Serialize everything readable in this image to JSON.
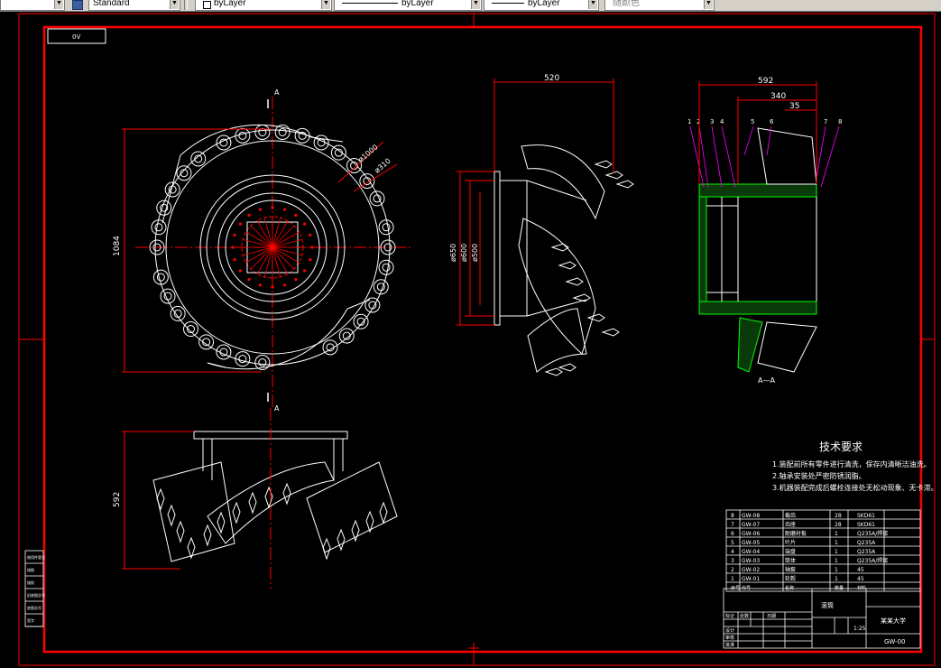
{
  "toolbar": {
    "text_style": "Standard",
    "layer": "byLayer",
    "linetype": "byLayer",
    "lineweight": "byLayer",
    "plot_color": "随颜色"
  },
  "drawing": {
    "sheet_tag": "0V",
    "dims": {
      "width_520": "520",
      "width_592": "592",
      "width_340": "340",
      "width_35": "35",
      "height_1084": "1084",
      "height_592": "592",
      "dia_1000": "ø1000",
      "dia_310": "ø310",
      "dia_650": "ø650",
      "dia_600": "ø600",
      "dia_500": "ø500"
    },
    "section_mark_top": "A",
    "section_mark_bottom": "A",
    "section_label": "A—A",
    "balloons": [
      "1",
      "2",
      "3",
      "4",
      "5",
      "6",
      "7",
      "8"
    ]
  },
  "tech_requirements": {
    "title": "技术要求",
    "items": [
      "1.装配前所有零件进行清洗，保存内清晰洁油洗。",
      "2.轴承安装处严密防锈润脂。",
      "3.机器装配完成后螺栓连接处无松动现象、无卡滞。"
    ]
  },
  "bom": {
    "rows": [
      {
        "no": "8",
        "code": "GW-08",
        "name": "截齿",
        "qty": "28",
        "material": "SKD61"
      },
      {
        "no": "7",
        "code": "GW-07",
        "name": "齿座",
        "qty": "28",
        "material": "SKD61"
      },
      {
        "no": "6",
        "code": "GW-06",
        "name": "耐磨衬板",
        "qty": "1",
        "material": "Q235A/焊接"
      },
      {
        "no": "5",
        "code": "GW-05",
        "name": "叶片",
        "qty": "1",
        "material": "Q235A"
      },
      {
        "no": "4",
        "code": "GW-04",
        "name": "端盘",
        "qty": "1",
        "material": "Q235A"
      },
      {
        "no": "3",
        "code": "GW-03",
        "name": "筒体",
        "qty": "1",
        "material": "Q235A/焊接"
      },
      {
        "no": "2",
        "code": "GW-02",
        "name": "轴套",
        "qty": "1",
        "material": "45"
      },
      {
        "no": "1",
        "code": "GW-01",
        "name": "轮毂",
        "qty": "1",
        "material": "45"
      }
    ],
    "header": {
      "no": "序号",
      "code": "代号",
      "name": "名称",
      "qty": "数量",
      "material": "材料"
    }
  },
  "title_block": {
    "drawing_name": "滚筒",
    "company": "某某大学",
    "drawing_no": "GW-00",
    "scale": "1:25",
    "labels": {
      "design": "设计",
      "check": "审核",
      "approve": "批准",
      "mark": "标记",
      "qty": "处数",
      "date": "日期"
    }
  },
  "side_table": {
    "labels": [
      "借用件登记",
      "描图",
      "描校",
      "旧底图总号",
      "底图总号",
      "签字"
    ]
  },
  "colors": {
    "frame": "#ff0000",
    "lines": "#ffffff",
    "hatch": "#00ff00",
    "leaders": "#ff00ff",
    "background": "#000000"
  }
}
